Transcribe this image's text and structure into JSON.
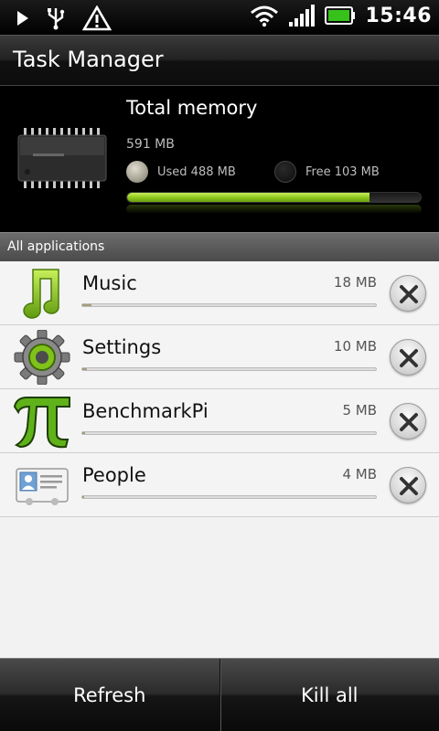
{
  "status_bar": {
    "time": "15:46",
    "icons_left": [
      "play-icon",
      "usb-icon",
      "warning-icon"
    ],
    "icons_right": [
      "wifi-icon",
      "signal-icon",
      "battery-icon"
    ]
  },
  "header": {
    "title": "Task Manager"
  },
  "memory": {
    "title": "Total memory",
    "total": "591 MB",
    "used_label": "Used 488 MB",
    "free_label": "Free 103 MB",
    "used_fraction": 0.826
  },
  "section_header": "All applications",
  "apps": [
    {
      "name": "Music",
      "size": "18 MB",
      "icon": "music-note-icon",
      "usage_fraction": 0.03
    },
    {
      "name": "Settings",
      "size": "10 MB",
      "icon": "settings-gear-icon",
      "usage_fraction": 0.017
    },
    {
      "name": "BenchmarkPi",
      "size": "5 MB",
      "icon": "pi-icon",
      "usage_fraction": 0.009
    },
    {
      "name": "People",
      "size": "4 MB",
      "icon": "contact-card-icon",
      "usage_fraction": 0.007
    }
  ],
  "buttons": {
    "refresh": "Refresh",
    "kill_all": "Kill all"
  },
  "colors": {
    "accent": "#8cc41a",
    "list_bg": "#f4f4f4",
    "app_bar": "#a49c7a"
  }
}
